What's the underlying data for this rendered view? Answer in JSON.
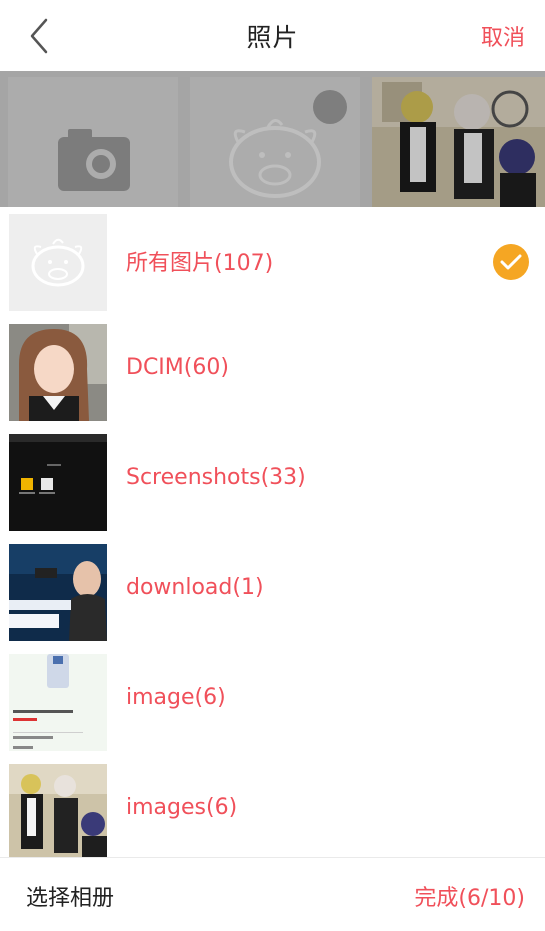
{
  "header": {
    "title": "照片",
    "cancel_label": "取消"
  },
  "background_grid": {
    "cells": [
      "camera-icon",
      "pig-placeholder",
      "anime-photo"
    ]
  },
  "albums": [
    {
      "label": "所有图片(107)",
      "thumb": "pig-placeholder",
      "selected": true
    },
    {
      "label": "DCIM(60)",
      "thumb": "selfie-photo",
      "selected": false
    },
    {
      "label": "Screenshots(33)",
      "thumb": "dark-screenshot",
      "selected": false
    },
    {
      "label": "download(1)",
      "thumb": "poster-photo",
      "selected": false
    },
    {
      "label": "image(6)",
      "thumb": "product-screenshot",
      "selected": false
    },
    {
      "label": "images(6)",
      "thumb": "anime-photo",
      "selected": false
    }
  ],
  "footer": {
    "select_album_label": "选择相册",
    "done_label": "完成(6/10)"
  },
  "colors": {
    "accent": "#f0505a",
    "check": "#f5a623"
  }
}
